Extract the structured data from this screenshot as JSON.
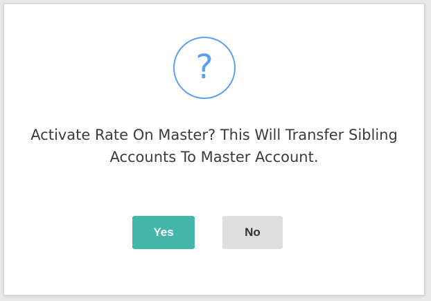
{
  "dialog": {
    "icon": "question-mark-icon",
    "icon_glyph": "?",
    "message": "Activate Rate On Master? This Will Transfer Sibling Accounts To Master Account.",
    "buttons": {
      "yes_label": "Yes",
      "no_label": "No"
    }
  },
  "colors": {
    "icon": "#5a9ff0",
    "yes_button": "#41b6a9",
    "no_button": "#dedede"
  }
}
